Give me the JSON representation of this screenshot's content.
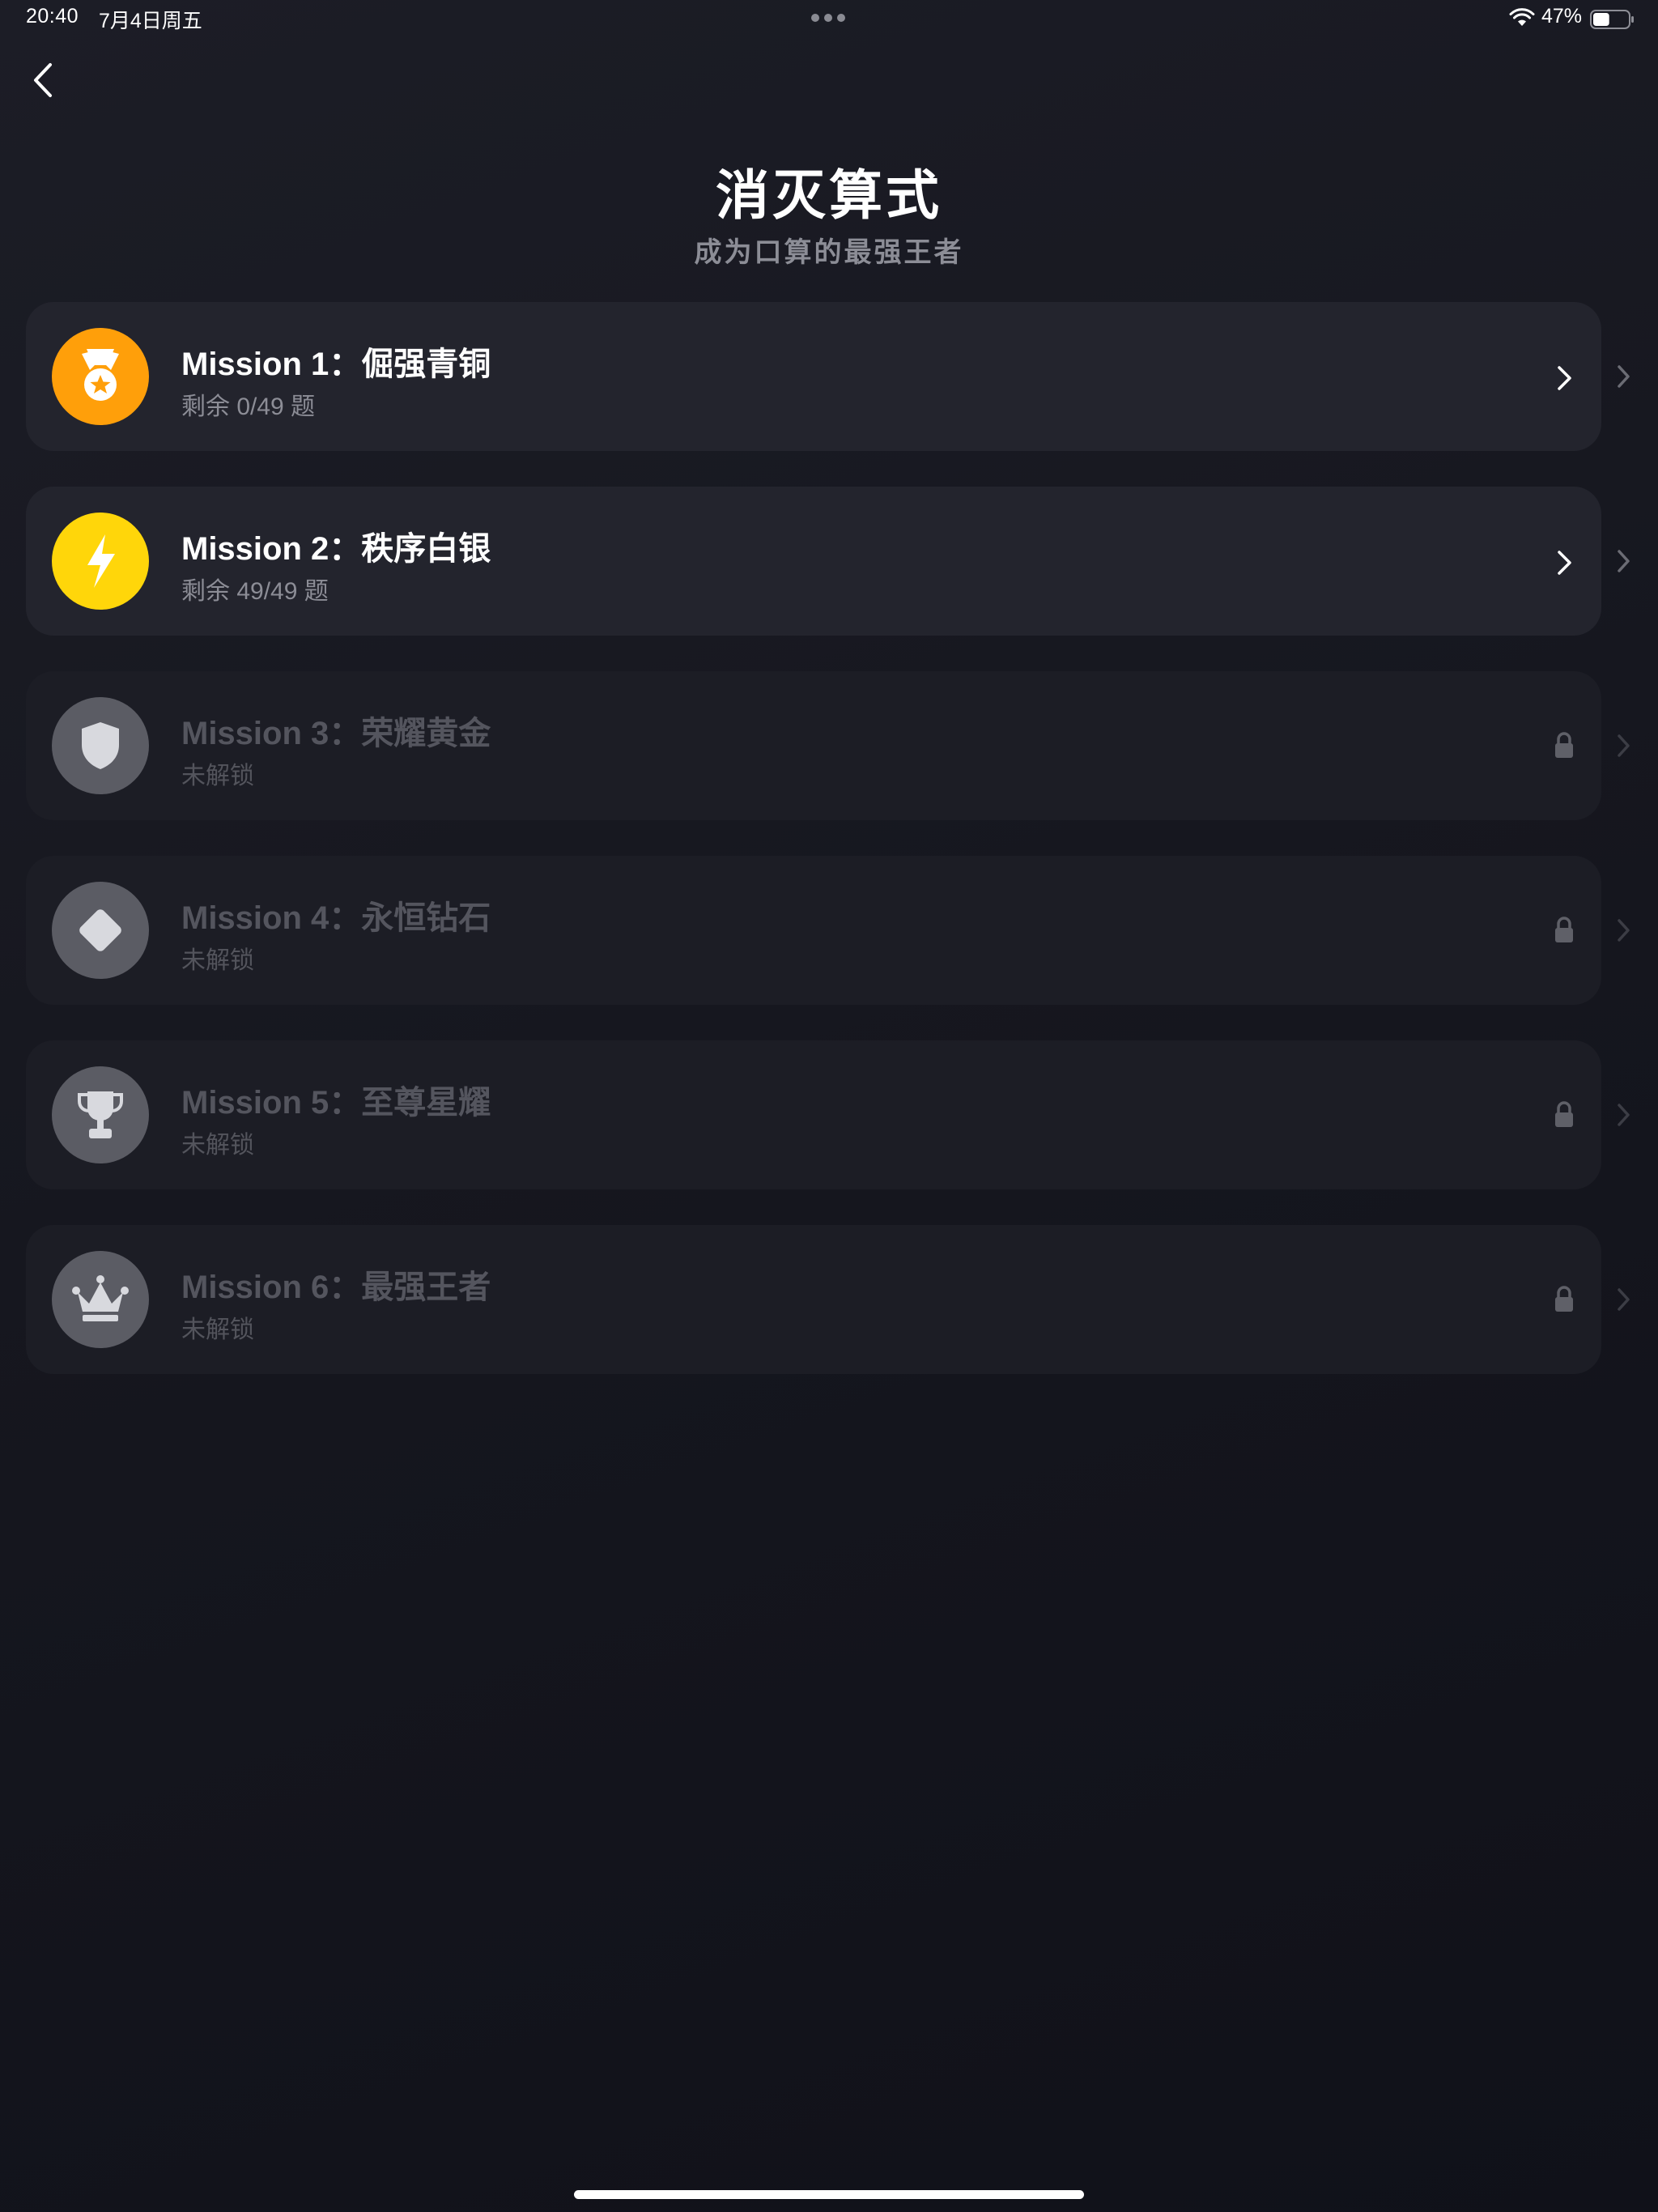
{
  "status_bar": {
    "time": "20:40",
    "date": "7月4日周五",
    "battery": "47%",
    "battery_level": 0.47
  },
  "header": {
    "title": "消灭算式",
    "subtitle": "成为口算的最强王者"
  },
  "colors": {
    "bronze": "#ff9f0a",
    "silver_accent": "#ffd60a",
    "locked_badge": "#5b5c64"
  },
  "missions": [
    {
      "title": "Mission 1：倔强青铜",
      "status": "剩余 0/49 题",
      "icon": "medal-icon",
      "locked": false
    },
    {
      "title": "Mission 2：秩序白银",
      "status": "剩余 49/49 题",
      "icon": "lightning-icon",
      "locked": false
    },
    {
      "title": "Mission 3：荣耀黄金",
      "status": "未解锁",
      "icon": "shield-icon",
      "locked": true
    },
    {
      "title": "Mission 4：永恒钻石",
      "status": "未解锁",
      "icon": "diamond-icon",
      "locked": true
    },
    {
      "title": "Mission 5：至尊星耀",
      "status": "未解锁",
      "icon": "trophy-icon",
      "locked": true
    },
    {
      "title": "Mission 6：最强王者",
      "status": "未解锁",
      "icon": "crown-icon",
      "locked": true
    }
  ]
}
